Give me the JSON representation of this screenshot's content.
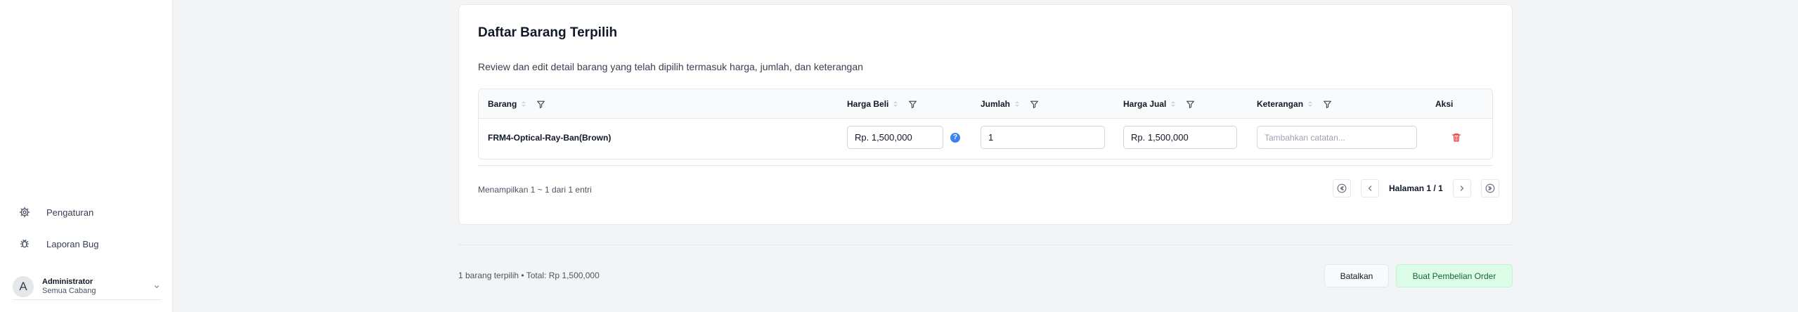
{
  "sidebar": {
    "items": [
      {
        "label": "Pengaturan",
        "icon": "gear-icon"
      },
      {
        "label": "Laporan Bug",
        "icon": "bug-icon"
      }
    ],
    "user": {
      "initial": "A",
      "name": "Administrator",
      "branch": "Semua Cabang"
    }
  },
  "card": {
    "title": "Daftar Barang Terpilih",
    "description": "Review dan edit detail barang yang telah dipilih termasuk harga, jumlah, dan keterangan",
    "columns": [
      "Barang",
      "Harga Beli",
      "Jumlah",
      "Harga Jual",
      "Keterangan",
      "Aksi"
    ],
    "rows": [
      {
        "barang": "FRM4-Optical-Ray-Ban(Brown)",
        "harga_beli": "Rp. 1,500,000",
        "jumlah": "1",
        "harga_jual": "Rp. 1,500,000",
        "keterangan_placeholder": "Tambahkan catatan..."
      }
    ],
    "showing": "Menampilkan 1 ~ 1 dari 1 entri",
    "page_prefix": "Halaman ",
    "page_current": "1",
    "page_sep": " / ",
    "page_total": "1"
  },
  "footer": {
    "summary": "1 barang terpilih • Total: Rp 1,500,000",
    "cancel_label": "Batalkan",
    "create_label": "Buat Pembelian Order"
  },
  "colors": {
    "delete": "#ef4444",
    "help": "#3b82f6",
    "primary_soft": "#dcfce7",
    "primary_text": "#166534"
  }
}
